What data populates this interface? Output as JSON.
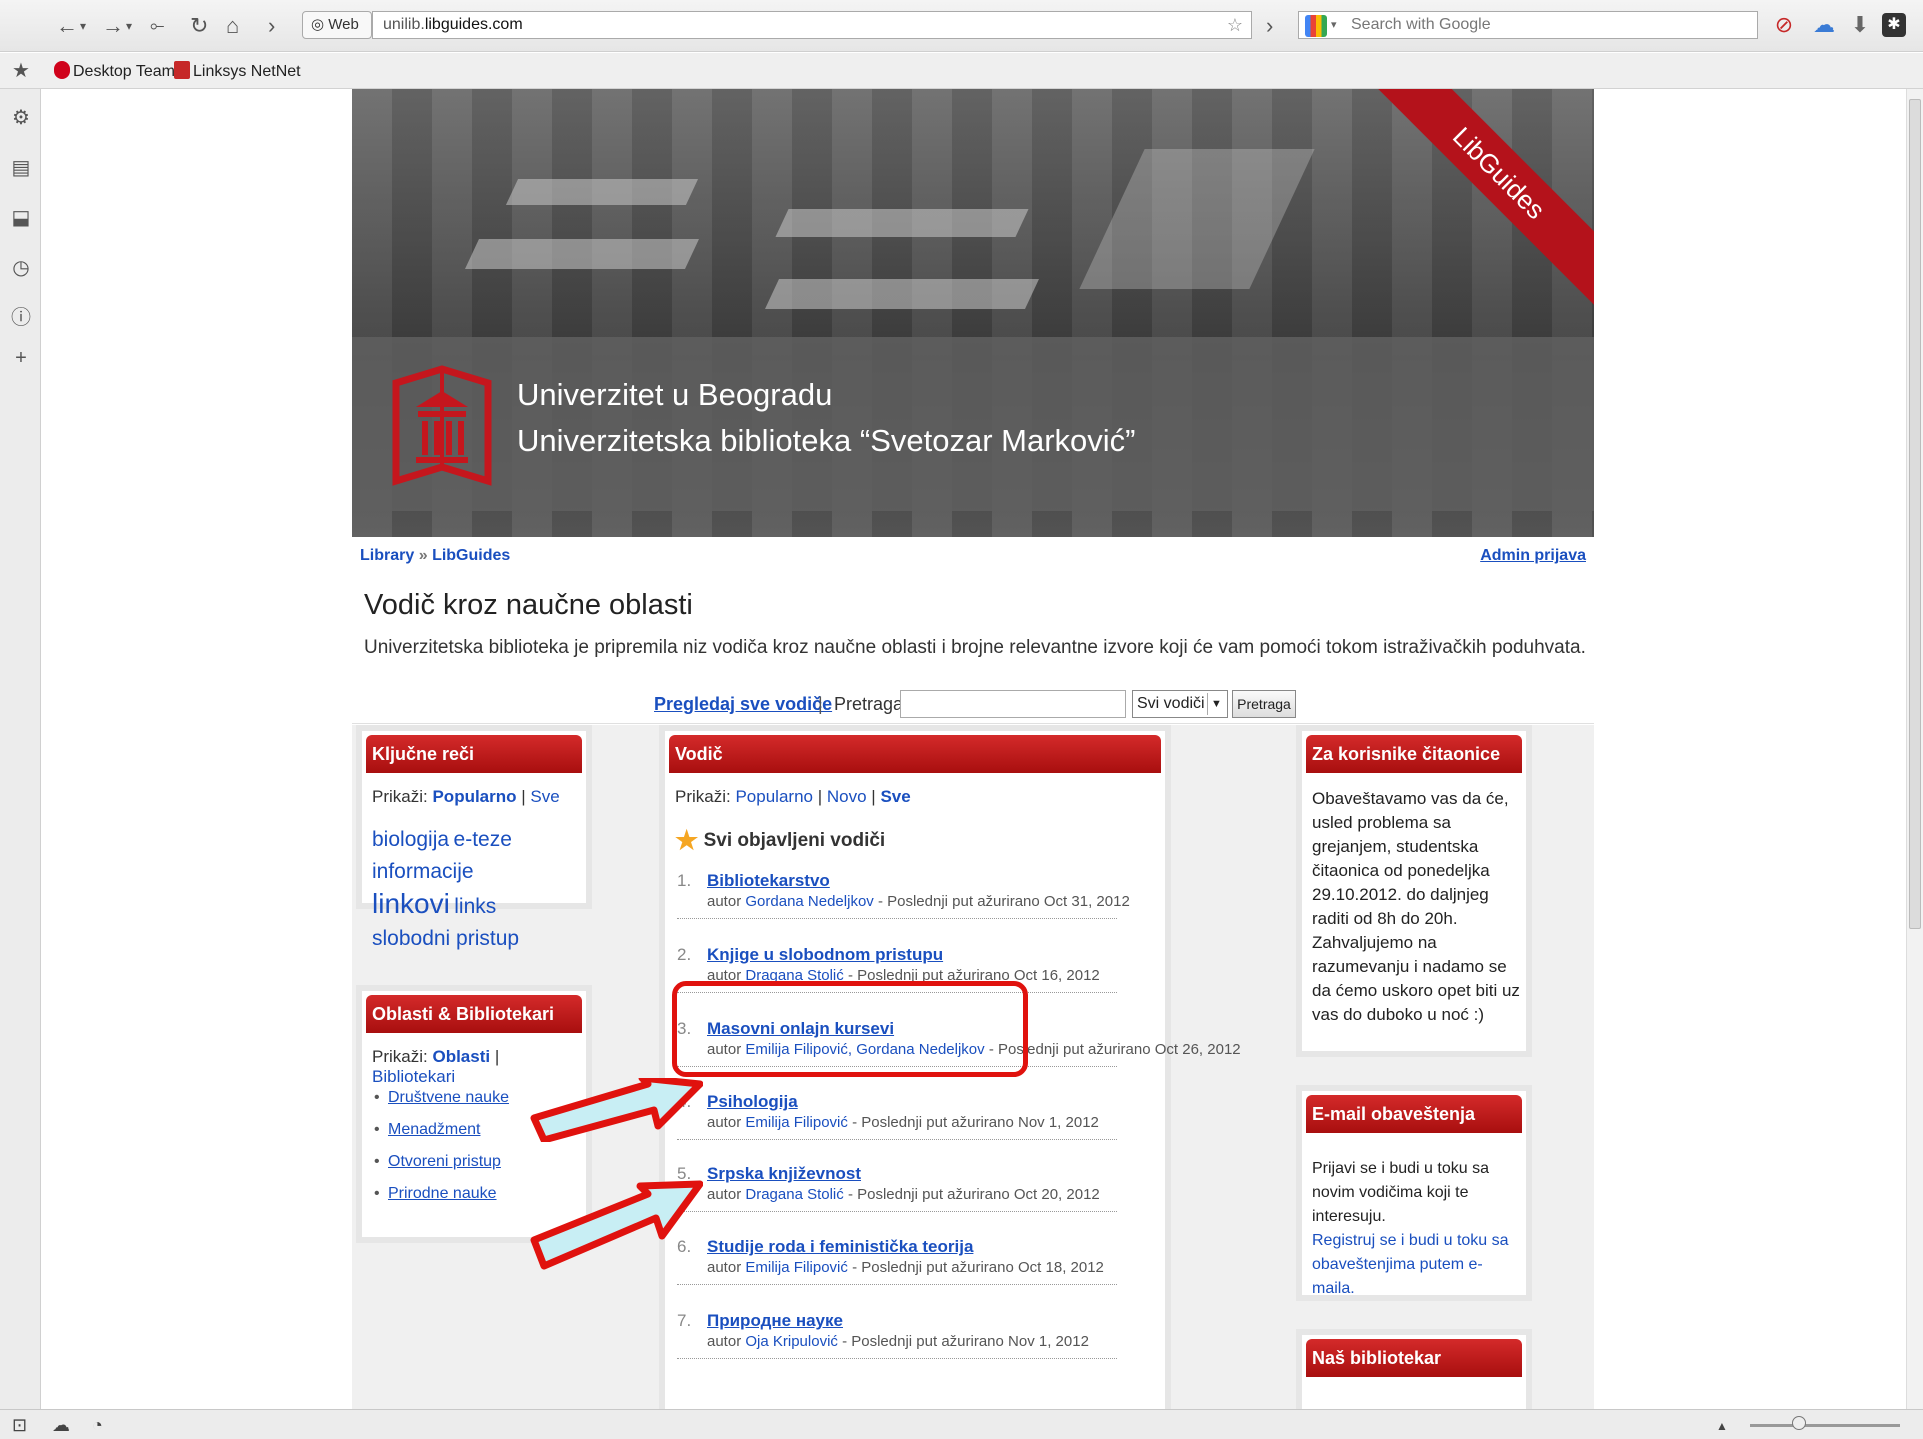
{
  "browser": {
    "web_label": "Web",
    "url_prefix": "unilib.",
    "url_domain": "libguides.com",
    "search_placeholder": "Search with Google",
    "bookmarks": [
      "Desktop Team",
      "Linksys NetNet"
    ]
  },
  "banner": {
    "university": "Univerzitet u Beogradu",
    "library": "Univerzitetska biblioteka “Svetozar Marković”",
    "ribbon": "LibGuides"
  },
  "breadcrumb": {
    "library": "Library",
    "sep": "»",
    "libguides": "LibGuides"
  },
  "admin_login": "Admin prijava",
  "page_title": "Vodič kroz naučne oblasti",
  "page_desc": "Univerzitetska biblioteka je pripremila niz vodiča kroz naučne oblasti i brojne relevantne izvore koji će vam pomoći tokom istraživačkih poduhvata.",
  "search": {
    "browse_all": "Pregledaj sve vodiče",
    "sep": "|",
    "label": "Pretraga:",
    "scope": "Svi vodiči",
    "button": "Pretraga"
  },
  "keywords": {
    "title": "Ključne reči",
    "show_label": "Prikaži:",
    "popular": "Popularno",
    "sep": "|",
    "all": "Sve",
    "tags": [
      "biologija",
      "e-teze",
      "informacije",
      "linkovi",
      "links",
      "slobodni pristup"
    ]
  },
  "subjects": {
    "title": "Oblasti & Bibliotekari",
    "show_label": "Prikaži:",
    "areas": "Oblasti",
    "sep": "|",
    "librarians": "Bibliotekari",
    "items": [
      "Društvene nauke",
      "Menadžment",
      "Otvoreni pristup",
      "Prirodne nauke"
    ]
  },
  "guides": {
    "title": "Vodič",
    "show_label": "Prikaži:",
    "popular": "Popularno",
    "new": "Novo",
    "all": "Sve",
    "sep": "|",
    "heading": "Svi objavljeni vodiči",
    "author_prefix": "autor",
    "items": [
      {
        "num": "1.",
        "title": "Bibliotekarstvo",
        "authors": "Gordana Nedeljkov",
        "updated": "- Poslednji put ažurirano Oct 31, 2012"
      },
      {
        "num": "2.",
        "title": "Knjige u slobodnom pristupu",
        "authors": "Dragana Stolić",
        "updated": "- Poslednji put ažurirano Oct 16, 2012"
      },
      {
        "num": "3.",
        "title": "Masovni onlajn kursevi",
        "authors": "Emilija Filipović, Gordana Nedeljkov",
        "updated": "- Poslednji put ažurirano Oct 26, 2012"
      },
      {
        "num": "4.",
        "title": "Psihologija",
        "authors": "Emilija Filipović",
        "updated": "- Poslednji put ažurirano Nov 1, 2012"
      },
      {
        "num": "5.",
        "title": "Srpska književnost",
        "authors": "Dragana Stolić",
        "updated": "- Poslednji put ažurirano Oct 20, 2012"
      },
      {
        "num": "6.",
        "title": "Studije roda i feministička teorija",
        "authors": "Emilija Filipović",
        "updated": "- Poslednji put ažurirano Oct 18, 2012"
      },
      {
        "num": "7.",
        "title": "Природне науке",
        "authors": "Oja Kripulović",
        "updated": "- Poslednji put ažurirano Nov 1, 2012"
      }
    ]
  },
  "readers": {
    "title": "Za korisnike čitaonice",
    "text": "Obaveštavamo vas da će, usled problema sa grejanjem, studentska čitaonica od ponedeljka 29.10.2012. do daljnjeg raditi od 8h do 20h. Zahvaljujemo na razumevanju i nadamo se da ćemo uskoro opet biti uz vas do duboko u noć :)"
  },
  "email": {
    "title": "E-mail obaveštenja",
    "text": "Prijavi se i budi u toku sa novim vodičima koji te interesuju.",
    "link": "Registruj se i budi u toku sa obaveštenjima putem e-maila."
  },
  "librarian": {
    "title": "Naš bibliotekar"
  },
  "colors": {
    "header_red": "#b4121b",
    "link_blue": "#1a4fbf",
    "annotation_red": "#e0120e"
  },
  "icons": [
    "back-icon",
    "forward-icon",
    "reload-icon",
    "home-icon",
    "star-icon",
    "gear-icon",
    "notes-icon",
    "download-icon",
    "history-icon",
    "info-icon",
    "plus-icon"
  ]
}
